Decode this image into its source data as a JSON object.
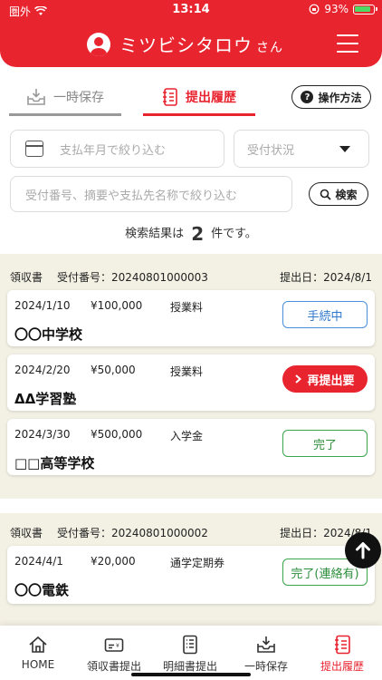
{
  "status_bar": {
    "carrier": "圏外",
    "time": "13:14",
    "battery": "93%"
  },
  "header": {
    "user_name": "ミツビシタロウ",
    "honorific": "さん"
  },
  "tabs": [
    {
      "label": "一時保存",
      "active": false
    },
    {
      "label": "提出履歴",
      "active": true
    }
  ],
  "howto_label": "操作方法",
  "filters": {
    "date_placeholder": "支払年月で絞り込む",
    "status_placeholder": "受付状況",
    "keyword_placeholder": "受付番号、摘要や支払先名称で絞り込む",
    "search_label": "検索"
  },
  "result": {
    "prefix": "検索結果は",
    "count": "2",
    "suffix": "件です。"
  },
  "groups": [
    {
      "doc_type": "領収書",
      "receipt_no": "受付番号：20240801000003",
      "submitted": "提出日：2024/8/1",
      "cards": [
        {
          "date": "2024/1/10",
          "amount": "¥100,000",
          "item": "授業料",
          "payee": "〇〇中学校",
          "status": "手続中",
          "status_type": "proc"
        },
        {
          "date": "2024/2/20",
          "amount": "¥50,000",
          "item": "授業料",
          "payee": "ΔΔ学習塾",
          "status": "再提出要",
          "status_type": "resub"
        },
        {
          "date": "2024/3/30",
          "amount": "¥500,000",
          "item": "入学金",
          "payee": "□□高等学校",
          "status": "完了",
          "status_type": "done"
        }
      ]
    },
    {
      "doc_type": "領収書",
      "receipt_no": "受付番号：20240801000002",
      "submitted": "提出日：2024/8/1",
      "cards": [
        {
          "date": "2024/4/1",
          "amount": "¥20,000",
          "item": "通学定期券",
          "payee": "〇〇電鉄",
          "status": "完了(連絡有)",
          "status_type": "done"
        }
      ]
    }
  ],
  "bottom_nav": [
    {
      "label": "HOME",
      "icon": "home-icon",
      "active": false
    },
    {
      "label": "領収書提出",
      "icon": "receipt-icon",
      "active": false
    },
    {
      "label": "明細書提出",
      "icon": "statement-icon",
      "active": false
    },
    {
      "label": "一時保存",
      "icon": "inbox-icon",
      "active": false
    },
    {
      "label": "提出履歴",
      "icon": "history-icon",
      "active": true
    }
  ],
  "colors": {
    "brand": "#e8242f",
    "group_bg": "#f3f0e4"
  }
}
